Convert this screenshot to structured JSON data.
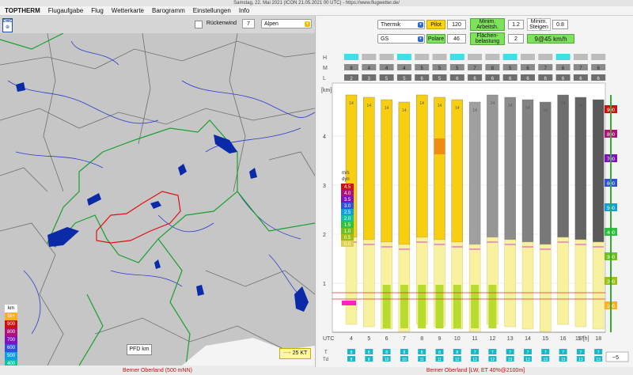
{
  "window": {
    "title": "Samstag, 22. Mai 2021 (ICON 21.05.2021 00 UTC) - https://www.flugwetter.de/"
  },
  "menu": [
    "TOPTHERM",
    "Flugaufgabe",
    "Flug",
    "Wetterkarte",
    "Barogramm",
    "Einstellungen",
    "Info"
  ],
  "map": {
    "rueckenwind_label": "Rückenwind",
    "rueckenwind_value": "7",
    "region": "Alpen",
    "pfd_label": "PFD",
    "km_label": "km",
    "wind_scale": "25 KT",
    "legend_title": "km",
    "legend": [
      {
        "label": "1k+",
        "color": "#ffb020"
      },
      {
        "label": "900",
        "color": "#cc1010"
      },
      {
        "label": "800",
        "color": "#b0107a"
      },
      {
        "label": "700",
        "color": "#8010c0"
      },
      {
        "label": "600",
        "color": "#3050e0"
      },
      {
        "label": "500",
        "color": "#10a0e0"
      },
      {
        "label": "400",
        "color": "#10c0a0"
      },
      {
        "label": "300",
        "color": "#30c040"
      },
      {
        "label": "200",
        "color": "#70c020"
      },
      {
        "label": "100",
        "color": "#a0c010"
      }
    ]
  },
  "controls": {
    "mode": "Thermik",
    "pilot_label": "Pilot",
    "pilot_value": "120",
    "min_arbeit_label": "Minim. Arbeitsh.",
    "min_arbeit_value": "1.2",
    "min_steigen_label": "Minim. Steigen",
    "min_steigen_value": "0.8",
    "glider": "GS",
    "polare_label": "Polare",
    "polare_value": "46",
    "flaechen_label": "Flächen-belastung",
    "flaechen_value": "2",
    "wind": "9@45 km/h"
  },
  "chart": {
    "row_labels": [
      "H",
      "M",
      "L"
    ],
    "y_unit": "[km]",
    "y_ticks": [
      "1",
      "2",
      "3",
      "4"
    ],
    "x_unit_left": "UTC",
    "x_unit_right": "19 [h]",
    "hours": [
      "4",
      "5",
      "6",
      "7",
      "8",
      "9",
      "10",
      "11",
      "12",
      "13",
      "14",
      "15",
      "16",
      "17",
      "18"
    ],
    "cloud_m": [
      "8",
      "4",
      "4",
      "4",
      "5",
      "5",
      "5",
      "7",
      "8",
      "5",
      "6",
      "7",
      "6",
      "7",
      "6"
    ],
    "cloud_l": [
      "2",
      "3",
      "5",
      "5",
      "6",
      "5",
      "6",
      "6",
      "6",
      "6",
      "6",
      "6",
      "6",
      "6",
      "6"
    ],
    "right_scale": [
      "900",
      "800",
      "700",
      "600",
      "500",
      "400",
      "300",
      "200",
      "100"
    ],
    "right_scale_colors": [
      "#cc1010",
      "#b0107a",
      "#8010c0",
      "#3050e0",
      "#10a0e0",
      "#30c040",
      "#70c020",
      "#a0c010",
      "#ffb020"
    ],
    "climb_title": "m/s",
    "climb_unit": "dyn",
    "climb": [
      {
        "label": "4.5",
        "color": "#cc1010"
      },
      {
        "label": "4.0",
        "color": "#b0107a"
      },
      {
        "label": "3.5",
        "color": "#8010c0"
      },
      {
        "label": "3.0",
        "color": "#3050e0"
      },
      {
        "label": "2.5",
        "color": "#10a0e0"
      },
      {
        "label": "2.0",
        "color": "#10c0a0"
      },
      {
        "label": "1.5",
        "color": "#30c040"
      },
      {
        "label": "1.0",
        "color": "#70c020"
      },
      {
        "label": "0.5",
        "color": "#a0c010"
      },
      {
        "label": "0.0",
        "color": "#e0d050"
      }
    ],
    "bar_label": "14",
    "temps_top": [
      "8",
      "8",
      "8",
      "8",
      "8",
      "8",
      "8",
      "7",
      "7",
      "7",
      "7",
      "7",
      "7",
      "7",
      "7"
    ],
    "temps_bottom": [
      "8",
      "8",
      "10",
      "10",
      "11",
      "11",
      "12",
      "12",
      "12",
      "13",
      "13",
      "13",
      "13",
      "13",
      "13"
    ],
    "t_label": "T",
    "td_label": "Td",
    "zoom": "~5"
  },
  "status": {
    "left": "Berner Oberland (500 mNN)",
    "right": "Berner Oberland [LW, ET  40%@2100m]"
  }
}
